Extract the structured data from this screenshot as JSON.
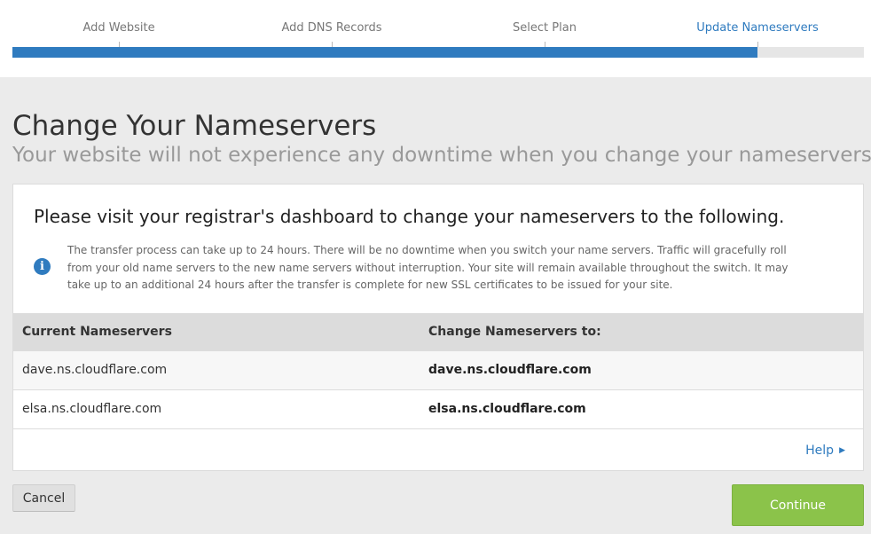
{
  "colors": {
    "accent": "#2f7bbf",
    "continue_green": "#8bc34a",
    "page_bg": "#ebebeb"
  },
  "progress": {
    "steps": [
      "Add Website",
      "Add DNS Records",
      "Select Plan",
      "Update Nameservers"
    ],
    "active_step": 3,
    "fraction_complete": 0.875
  },
  "page": {
    "title": "Change Your Nameservers",
    "subtitle": "Your website will not experience any downtime when you change your nameservers."
  },
  "card": {
    "heading": "Please visit your registrar's dashboard to change your nameservers to the following.",
    "info_icon": "info-circle-icon",
    "info_text": "The transfer process can take up to 24 hours. There will be no downtime when you switch your name servers. Traffic will gracefully roll from your old name servers to the new name servers without interruption. Your site will remain available throughout the switch. It may take up to an additional 24 hours after the transfer is complete for new SSL certificates to be issued for your site.",
    "table": {
      "headers": [
        "Current Nameservers",
        "Change Nameservers to:"
      ],
      "rows": [
        [
          "dave.ns.cloudflare.com",
          "dave.ns.cloudflare.com"
        ],
        [
          "elsa.ns.cloudflare.com",
          "elsa.ns.cloudflare.com"
        ]
      ]
    },
    "help_label": "Help"
  },
  "actions": {
    "cancel_label": "Cancel",
    "continue_label": "Continue"
  }
}
